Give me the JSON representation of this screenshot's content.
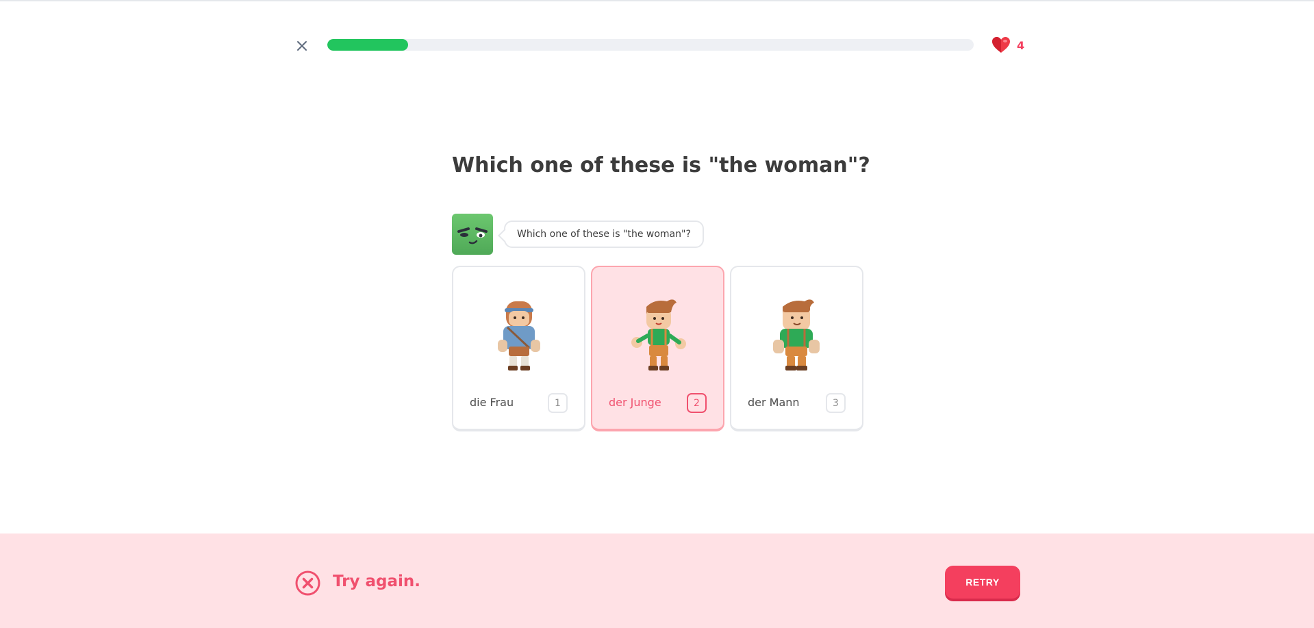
{
  "header": {
    "close_icon": "close-icon",
    "progress_percent": 12.5,
    "hearts_icon": "heart-icon",
    "hearts_count": "4",
    "colors": {
      "progress": "#22c55e",
      "hearts": "#f43f5e"
    }
  },
  "question": {
    "title": "Which one of these is \"the woman\"?",
    "bubble_text": "Which one of these is \"the woman\"?"
  },
  "options": [
    {
      "label": "die Frau",
      "key": "1",
      "icon": "woman-character-icon",
      "selected": false
    },
    {
      "label": "der Junge",
      "key": "2",
      "icon": "boy-character-icon",
      "selected": true
    },
    {
      "label": "der Mann",
      "key": "3",
      "icon": "man-character-icon",
      "selected": false
    }
  ],
  "footer": {
    "status_icon": "x-circle-icon",
    "status_text": "Try again.",
    "retry_label": "RETRY",
    "colors": {
      "background": "#ffe1e5",
      "accent": "#f0506e",
      "button": "#f43f5e"
    }
  }
}
